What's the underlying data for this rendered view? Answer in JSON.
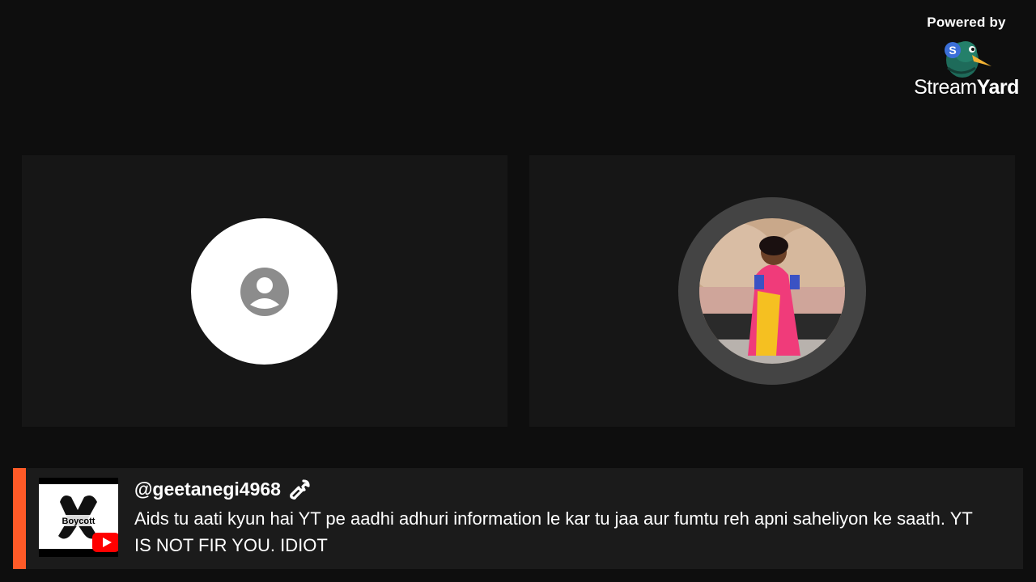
{
  "branding": {
    "powered_by": "Powered by",
    "name_regular": "Stream",
    "name_bold": "Yard",
    "logo_icon": "duck-logo-icon"
  },
  "participants": [
    {
      "icon": "default-user-icon"
    },
    {
      "icon": "user-photo"
    }
  ],
  "comment": {
    "author": "@geetanegi4968",
    "author_badge_icon": "wrench-icon",
    "text": "Aids tu aati kyun hai YT pe aadhi adhuri information le kar tu jaa aur fumtu reh apni saheliyon ke saath. YT IS NOT FIR YOU. IDIOT",
    "thumbnail_text": "Boycott",
    "thumbnail_badge": "youtube-icon",
    "accent_color": "#ff5a27"
  }
}
